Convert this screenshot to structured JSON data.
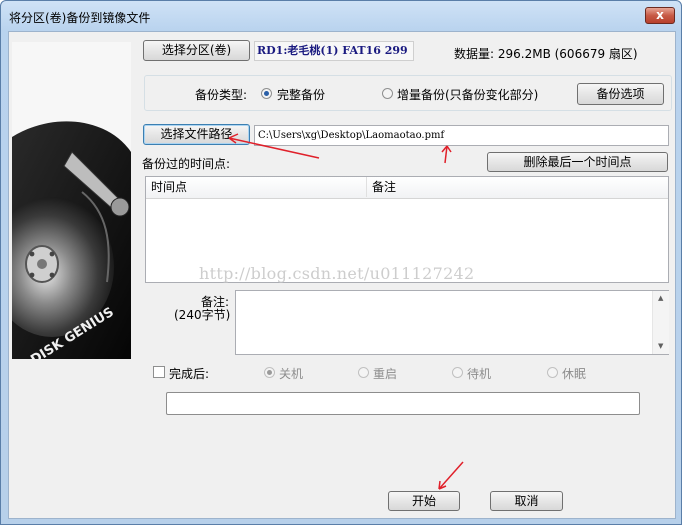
{
  "window": {
    "title": "将分区(卷)备份到镜像文件",
    "close_label": "x"
  },
  "partition": {
    "button_label": "选择分区(卷)",
    "info": "RD1:老毛桃(1) FAT16 299",
    "data_size": "数据量: 296.2MB (606679 扇区)"
  },
  "backup_type": {
    "label": "备份类型:",
    "option_full": "完整备份",
    "option_incremental": "增量备份(只备份变化部分)",
    "options_button": "备份选项",
    "selected": "完整备份"
  },
  "file": {
    "button_label": "选择文件路径",
    "path_value": "C:\\Users\\xg\\Desktop\\Laomaotao.pmf"
  },
  "timepoints": {
    "label": "备份过的时间点:",
    "delete_button": "删除最后一个时间点",
    "columns": [
      "时间点",
      "备注"
    ],
    "rows": []
  },
  "watermark": "http://blog.csdn.net/u011127242",
  "note": {
    "label": "备注:",
    "limit": "(240字节)",
    "value": ""
  },
  "after_completion": {
    "label": "完成后:",
    "options": [
      "关机",
      "重启",
      "待机",
      "休眠"
    ],
    "selected": "关机",
    "checked": false
  },
  "status_value": "",
  "actions": {
    "start": "开始",
    "cancel": "取消"
  },
  "image": {
    "brand_text": "DISK GENIUS"
  },
  "colors": {
    "annotation_arrow": "#e0202a",
    "partition_info_text": "#1a1a80"
  }
}
